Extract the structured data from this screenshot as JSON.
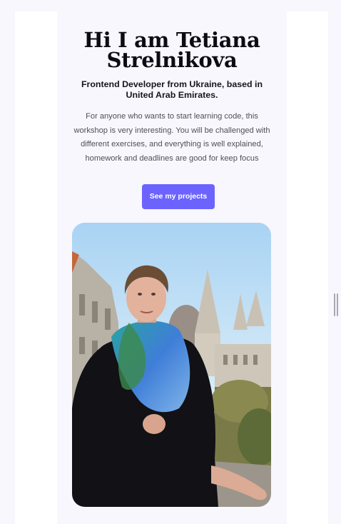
{
  "hero": {
    "title": "Hi I am Tetiana Strelnikova",
    "subtitle": "Frontend Developer from Ukraine, based in United Arab Emirates.",
    "description": "For anyone who wants to start learning code, this workshop is very interesting. You will be challenged with different exercises, and everything is well explained, homework and deadlines are good for keep focus",
    "cta_label": "See my projects"
  },
  "colors": {
    "accent": "#6c63ff",
    "background": "#f8f7fd",
    "heading": "#0d0c14",
    "body_text": "#4f4f5a"
  },
  "icons": {
    "scroll_handle": "resize-handle-icon"
  }
}
